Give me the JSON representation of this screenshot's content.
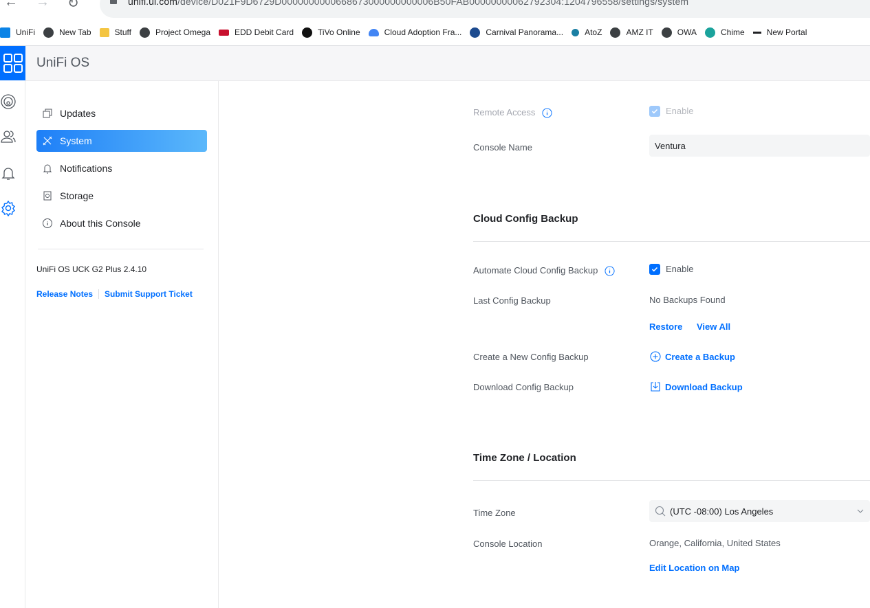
{
  "browser": {
    "url_host": "unifi.ui.com",
    "url_path": "/device/D021F9D6729D0000000000668673000000000006B50FAB00000000062792304:1204796558/settings/system",
    "bookmarks": [
      {
        "label": "UniFi",
        "icon": "unifi-icon"
      },
      {
        "label": "New Tab",
        "icon": "globe-icon"
      },
      {
        "label": "Stuff",
        "icon": "folder-icon"
      },
      {
        "label": "Project Omega",
        "icon": "globe-icon"
      },
      {
        "label": "EDD Debit Card",
        "icon": "card-icon"
      },
      {
        "label": "TiVo Online",
        "icon": "tivo-icon"
      },
      {
        "label": "Cloud Adoption Fra...",
        "icon": "cloud-icon"
      },
      {
        "label": "Carnival Panorama...",
        "icon": "ship-icon"
      },
      {
        "label": "AtoZ",
        "icon": "atoz-icon"
      },
      {
        "label": "AMZ IT",
        "icon": "globe-icon"
      },
      {
        "label": "OWA",
        "icon": "globe-icon"
      },
      {
        "label": "Chime",
        "icon": "chime-icon"
      },
      {
        "label": "New Portal",
        "icon": "dash-icon"
      }
    ]
  },
  "app": {
    "title": "UniFi OS",
    "accent": "#006fff"
  },
  "settings_nav": {
    "items": [
      {
        "label": "Updates",
        "icon": "updates-icon",
        "active": false
      },
      {
        "label": "System",
        "icon": "tools-icon",
        "active": true
      },
      {
        "label": "Notifications",
        "icon": "bell-icon",
        "active": false
      },
      {
        "label": "Storage",
        "icon": "storage-icon",
        "active": false
      },
      {
        "label": "About this Console",
        "icon": "info-icon",
        "active": false
      }
    ],
    "version": "UniFi OS UCK G2 Plus 2.4.10",
    "release_notes": "Release Notes",
    "support_ticket": "Submit Support Ticket"
  },
  "general": {
    "remote_access_label": "Remote Access",
    "remote_access_check": "Enable",
    "console_name_label": "Console Name",
    "console_name_value": "Ventura"
  },
  "cloud_backup": {
    "title": "Cloud Config Backup",
    "automate_label": "Automate Cloud Config Backup",
    "automate_check": "Enable",
    "last_backup_label": "Last Config Backup",
    "last_backup_value": "No Backups Found",
    "restore": "Restore",
    "view_all": "View All",
    "create_label": "Create a New Config Backup",
    "create_action": "Create a Backup",
    "download_label": "Download Config Backup",
    "download_action": "Download Backup"
  },
  "timezone": {
    "title": "Time Zone / Location",
    "tz_label": "Time Zone",
    "tz_value": "(UTC -08:00) Los Angeles",
    "location_label": "Console Location",
    "location_value": "Orange, California, United States",
    "edit_location": "Edit Location on Map"
  }
}
